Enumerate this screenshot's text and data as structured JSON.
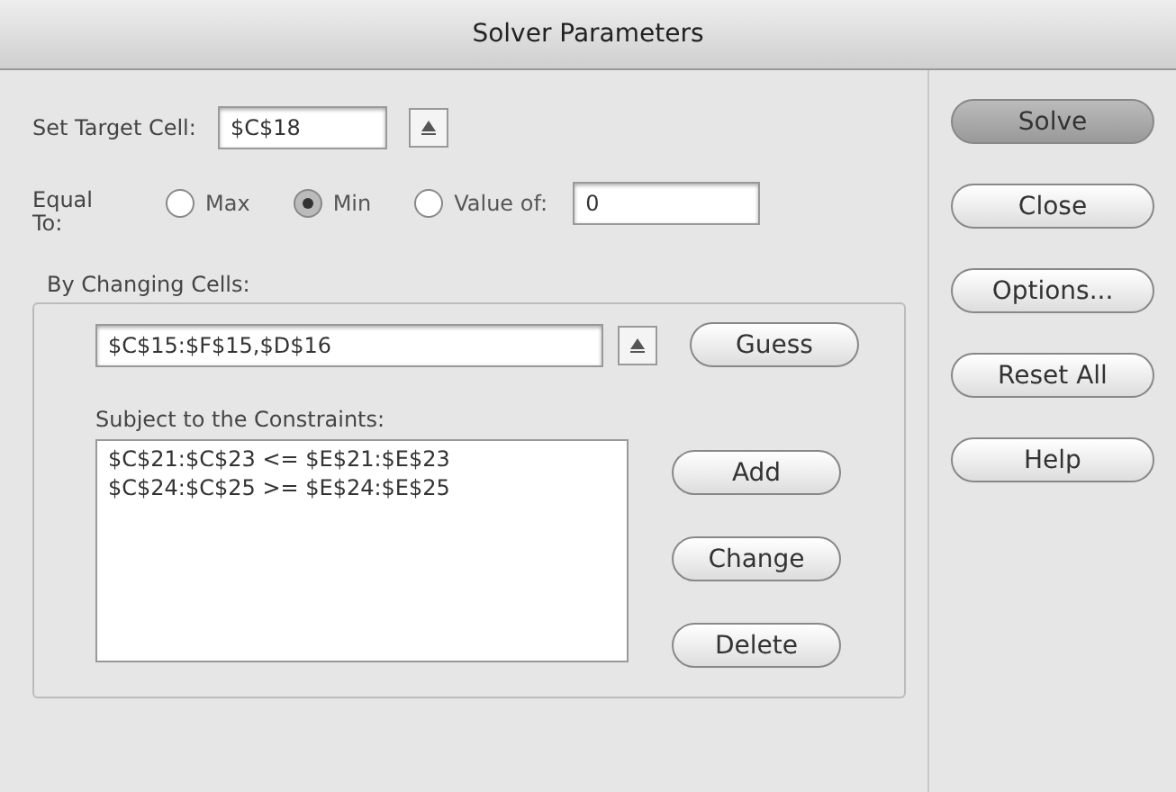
{
  "window": {
    "title": "Solver Parameters"
  },
  "target": {
    "label": "Set Target Cell:",
    "value": "$C$18"
  },
  "equal_to": {
    "label": "Equal To:",
    "options": [
      {
        "label": "Max",
        "selected": false
      },
      {
        "label": "Min",
        "selected": true
      },
      {
        "label": "Value of:",
        "selected": false
      }
    ],
    "value": "0"
  },
  "changing_cells": {
    "label": "By Changing Cells:",
    "value": "$C$15:$F$15,$D$16",
    "button": "Guess"
  },
  "constraints": {
    "label": "Subject to the Constraints:",
    "items": [
      "$C$21:$C$23 <= $E$21:$E$23",
      "$C$24:$C$25 >= $E$24:$E$25"
    ],
    "buttons": [
      "Add",
      "Change",
      "Delete"
    ]
  },
  "side_buttons": [
    {
      "label": "Solve",
      "default": true
    },
    {
      "label": "Close",
      "default": false
    },
    {
      "label": "Options...",
      "default": false
    },
    {
      "label": "Reset All",
      "default": false
    },
    {
      "label": "Help",
      "default": false
    }
  ]
}
